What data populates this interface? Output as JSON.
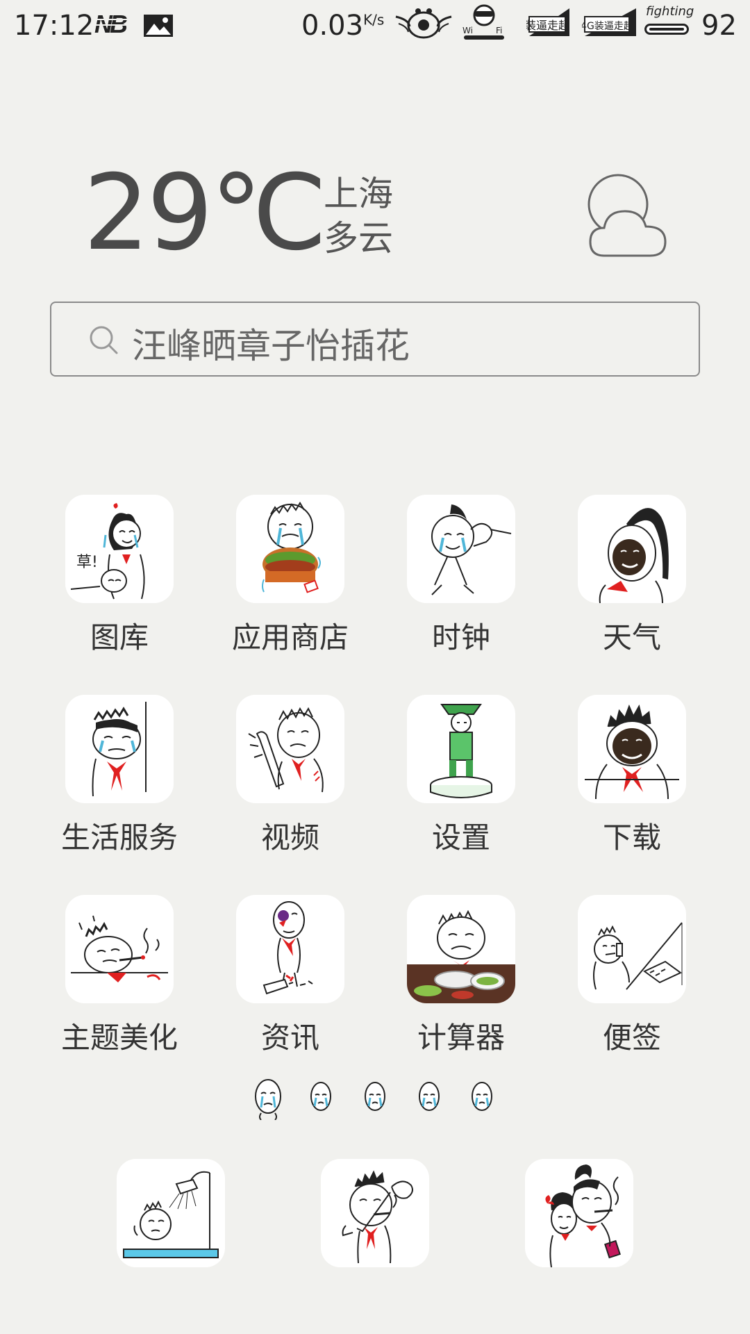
{
  "status_bar": {
    "time": "17:12",
    "net_speed": "0.03",
    "net_unit": "K/s",
    "signal_badge_1": "装逼走起",
    "signal_badge_2": "4G装逼走起",
    "battery_label": "fighting",
    "battery_percent": "92",
    "wifi_label": "Wi-Fi"
  },
  "weather": {
    "temperature": "29℃",
    "city": "上海",
    "condition": "多云",
    "icon": "partly-cloudy-icon"
  },
  "search": {
    "text": "汪峰晒章子怡插花",
    "icon": "search-icon"
  },
  "apps": [
    {
      "label": "图库"
    },
    {
      "label": "应用商店"
    },
    {
      "label": "时钟"
    },
    {
      "label": "天气"
    },
    {
      "label": "生活服务"
    },
    {
      "label": "视频"
    },
    {
      "label": "设置"
    },
    {
      "label": "下载"
    },
    {
      "label": "主题美化"
    },
    {
      "label": "资讯"
    },
    {
      "label": "计算器"
    },
    {
      "label": "便签"
    }
  ],
  "pager": {
    "pages": 5,
    "current": 1
  },
  "colors": {
    "background": "#f1f1ee",
    "tile": "#ffffff",
    "text": "#333333",
    "scarf_red": "#e02020",
    "tear_blue": "#4fb6d8"
  }
}
